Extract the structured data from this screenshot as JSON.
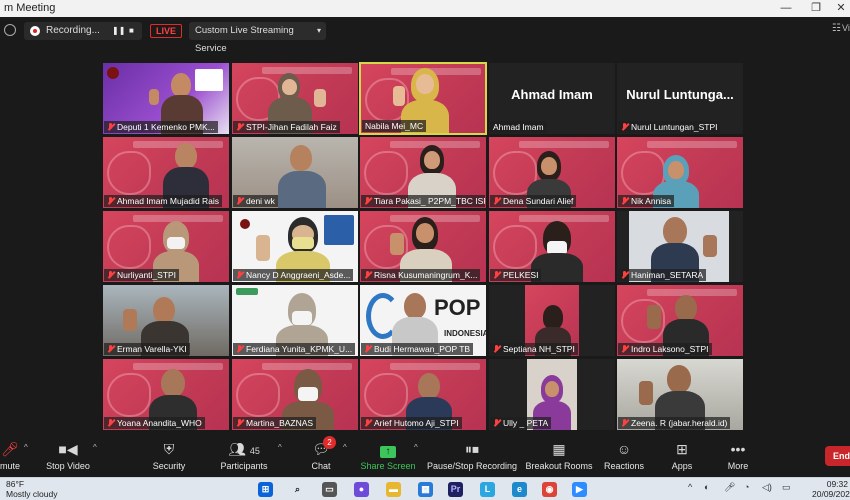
{
  "window": {
    "title": "m Meeting",
    "minimize": "—",
    "restore": "❐",
    "close": "✕"
  },
  "topbar": {
    "recording_label": "Recording...",
    "pause_glyph": "❚❚",
    "stop_glyph": "■",
    "live_label": "LIVE",
    "stream_label": "Custom Live Streaming Service",
    "stream_caret": "▾",
    "view_icon": "☷",
    "view_label": "Vi"
  },
  "tiles": [
    {
      "name": "Deputi 1 Kemenko PMK...",
      "muted": true
    },
    {
      "name": "STPI-Jihan Fadilah Faiz",
      "muted": true
    },
    {
      "name": "Nabila Mei_MC",
      "muted": false,
      "active_speaker": true
    },
    {
      "name": "Ahmad Imam",
      "muted": false,
      "video_off": true,
      "display_name": "Ahmad Imam"
    },
    {
      "name": "Nurul Luntungan_STPI",
      "muted": true,
      "video_off": true,
      "display_name": "Nurul Luntunga..."
    },
    {
      "name": "Ahmad Imam Mujadid Rais",
      "muted": true
    },
    {
      "name": "deni wk",
      "muted": true
    },
    {
      "name": "Tiara Pakasi_ P2PM_TBC ISPA",
      "muted": true
    },
    {
      "name": "Dena Sundari Alief",
      "muted": true
    },
    {
      "name": "Nik Annisa",
      "muted": true
    },
    {
      "name": "Nurliyanti_STPI",
      "muted": true
    },
    {
      "name": "Nancy D Anggraeni_Asde...",
      "muted": true
    },
    {
      "name": "Risna Kusumaningrum_K...",
      "muted": true
    },
    {
      "name": "PELKESI",
      "muted": true
    },
    {
      "name": "Haniman_SETARA",
      "muted": true
    },
    {
      "name": "Erman Varella-YKI",
      "muted": true
    },
    {
      "name": "Ferdiana Yunita_KPMK_U...",
      "muted": true
    },
    {
      "name": "Budi Hermawan_POP TB",
      "muted": true,
      "logo_text": "POP",
      "logo_sub": "INDONESIA"
    },
    {
      "name": "Septiana NH_STPI",
      "muted": true
    },
    {
      "name": "Indro Laksono_STPI",
      "muted": true
    },
    {
      "name": "Yoana Anandita_WHO",
      "muted": true
    },
    {
      "name": "Martina_BAZNAS",
      "muted": true
    },
    {
      "name": "Arief Hutomo Aji_STPI",
      "muted": true
    },
    {
      "name": "Ully _ PETA",
      "muted": true
    },
    {
      "name": "Zeena. R (jabar.herald.id)",
      "muted": true
    }
  ],
  "toolbar": {
    "unmute": "mute",
    "stop_video": "Stop Video",
    "security": "Security",
    "participants": "Participants",
    "participants_count": "45",
    "chat": "Chat",
    "chat_badge": "2",
    "share_screen": "Share Screen",
    "pause_stop_recording": "Pause/Stop Recording",
    "breakout_rooms": "Breakout Rooms",
    "reactions": "Reactions",
    "apps": "Apps",
    "more": "More",
    "end": "End"
  },
  "taskbar": {
    "temperature": "86°F",
    "weather": "Mostly cloudy",
    "time": "09:32",
    "date": "20/09/2022"
  }
}
